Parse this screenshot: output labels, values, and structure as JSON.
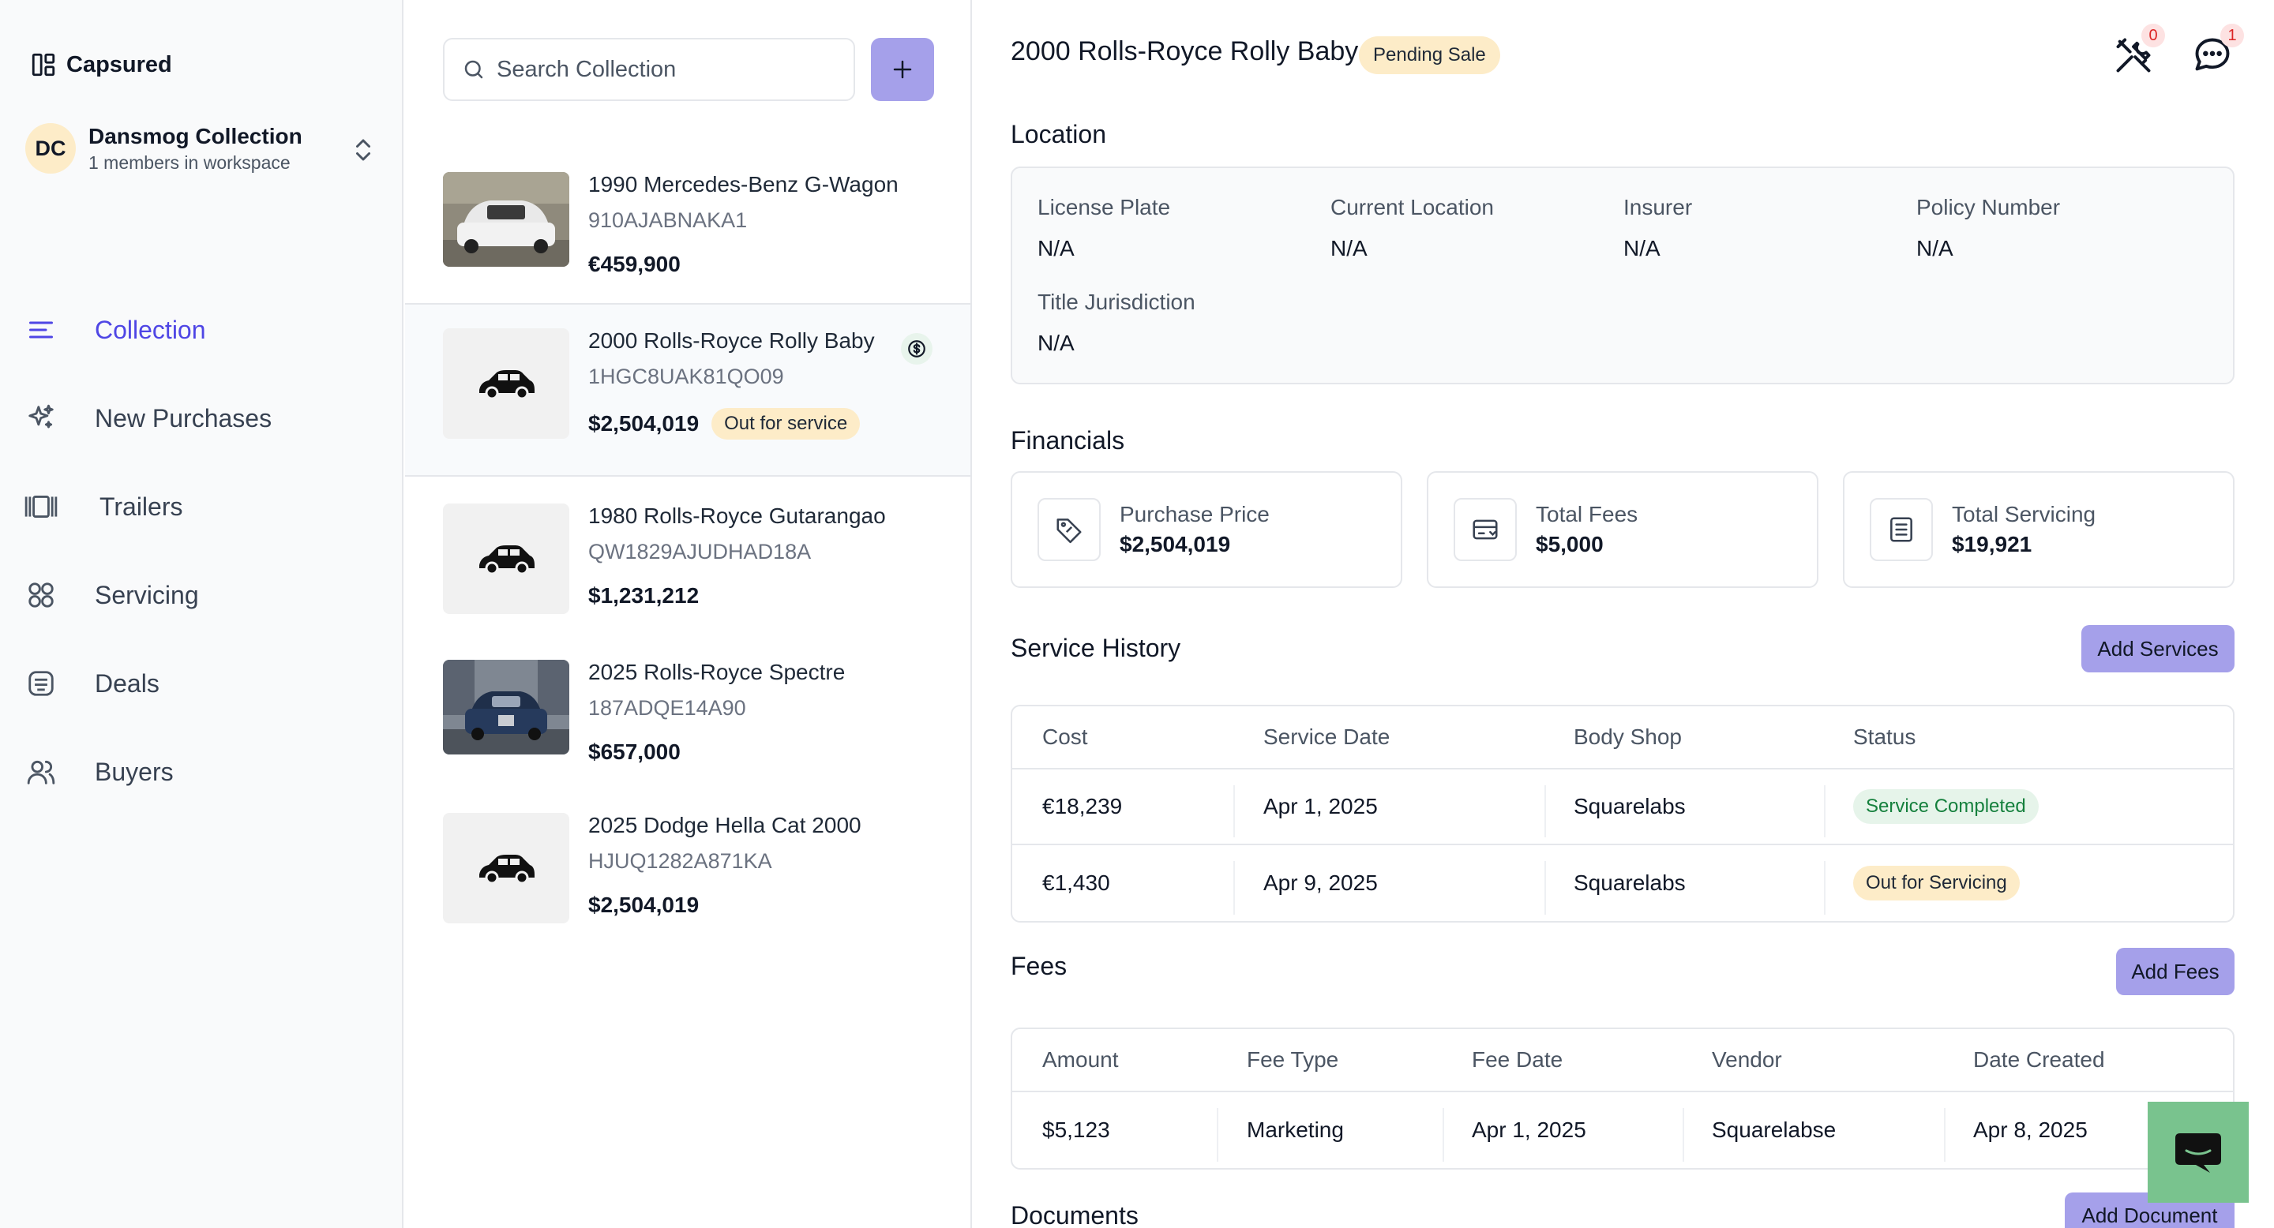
{
  "app": {
    "name": "Capsured"
  },
  "workspace": {
    "initials": "DC",
    "name": "Dansmog Collection",
    "members": "1 members in workspace"
  },
  "nav": [
    {
      "label": "Collection",
      "icon": "list-icon",
      "active": true
    },
    {
      "label": "New Purchases",
      "icon": "sparkles-icon"
    },
    {
      "label": "Trailers",
      "icon": "trailer-icon"
    },
    {
      "label": "Servicing",
      "icon": "grid-circles-icon"
    },
    {
      "label": "Deals",
      "icon": "deals-icon"
    },
    {
      "label": "Buyers",
      "icon": "buyers-icon"
    }
  ],
  "search": {
    "placeholder": "Search Collection"
  },
  "cars": [
    {
      "name": "1990 Mercedes-Benz G-Wagon",
      "vin": "910AJABNAKA1",
      "price": "€459,900",
      "thumb": "photo-white-car"
    },
    {
      "name": "2000 Rolls-Royce Rolly Baby",
      "vin": "1HGC8UAK81QO09",
      "price": "$2,504,019",
      "status": "Out for service",
      "selected": true,
      "thumb": "car-placeholder-icon"
    },
    {
      "name": "1980 Rolls-Royce Gutarangao",
      "vin": "QW1829AJUDHAD18A",
      "price": "$1,231,212",
      "thumb": "car-placeholder-icon"
    },
    {
      "name": "2025 Rolls-Royce Spectre",
      "vin": "187ADQE14A90",
      "price": "$657,000",
      "thumb": "photo-blue-car"
    },
    {
      "name": "2025 Dodge Hella Cat 2000",
      "vin": "HJUQ1282A871KA",
      "price": "$2,504,019",
      "thumb": "car-placeholder-icon"
    }
  ],
  "detail": {
    "title": "2000 Rolls-Royce Rolly Baby",
    "status": "Pending Sale",
    "tools_count": "0",
    "messages_count": "1",
    "location": {
      "title": "Location",
      "license_plate": {
        "label": "License Plate",
        "value": "N/A"
      },
      "current_location": {
        "label": "Current Location",
        "value": "N/A"
      },
      "insurer": {
        "label": "Insurer",
        "value": "N/A"
      },
      "policy_number": {
        "label": "Policy Number",
        "value": "N/A"
      },
      "title_jurisdiction": {
        "label": "Title Jurisdiction",
        "value": "N/A"
      }
    },
    "financials": {
      "title": "Financials",
      "purchase_price": {
        "label": "Purchase Price",
        "value": "$2,504,019"
      },
      "total_fees": {
        "label": "Total Fees",
        "value": "$5,000"
      },
      "total_servicing": {
        "label": "Total Servicing",
        "value": "$19,921"
      }
    },
    "service_history": {
      "title": "Service History",
      "add_label": "Add Services",
      "columns": [
        "Cost",
        "Service Date",
        "Body Shop",
        "Status"
      ],
      "rows": [
        {
          "cost": "€18,239",
          "date": "Apr 1, 2025",
          "shop": "Squarelabs",
          "status": "Service Completed"
        },
        {
          "cost": "€1,430",
          "date": "Apr 9, 2025",
          "shop": "Squarelabs",
          "status": "Out for Servicing"
        }
      ]
    },
    "fees": {
      "title": "Fees",
      "add_label": "Add Fees",
      "columns": [
        "Amount",
        "Fee Type",
        "Fee Date",
        "Vendor",
        "Date Created"
      ],
      "rows": [
        {
          "amount": "$5,123",
          "type": "Marketing",
          "date": "Apr 1, 2025",
          "vendor": "Squarelabse",
          "created": "Apr 8, 2025"
        }
      ]
    },
    "documents": {
      "title": "Documents",
      "add_label": "Add Document"
    }
  },
  "colors": {
    "accent": "#4f46e5",
    "button": "#a5a0ea",
    "pending": "#fdecc8",
    "chat": "#79c38e"
  }
}
